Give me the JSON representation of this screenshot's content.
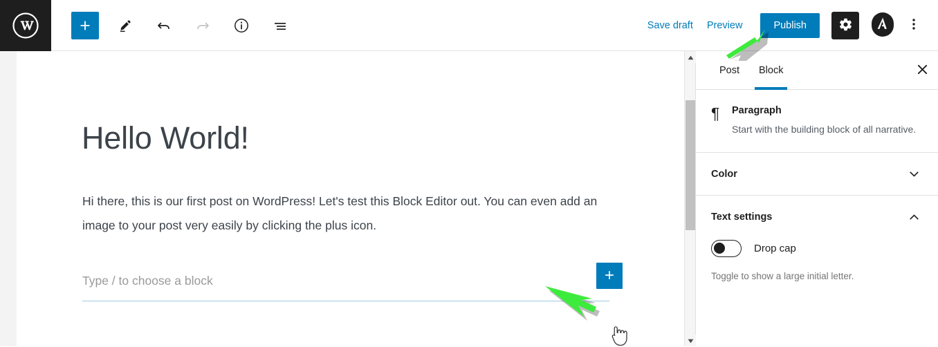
{
  "app": {
    "name": "WordPress Block Editor",
    "logo_icon": "wordpress-logo-icon"
  },
  "toolbar": {
    "add_block_label": "+",
    "add_block_icon": "plus-icon",
    "edit_icon": "pencil-icon",
    "undo_icon": "undo-arrow-icon",
    "redo_icon": "redo-arrow-icon",
    "info_icon": "info-circle-icon",
    "list_view_icon": "list-view-icon",
    "save_draft_label": "Save draft",
    "preview_label": "Preview",
    "publish_label": "Publish",
    "settings_icon": "gear-icon",
    "avatar_icon": "user-avatar-icon",
    "more_menu_icon": "kebab-menu-icon"
  },
  "editor": {
    "post_title": "Hello World!",
    "post_body": "Hi there, this is our first post on WordPress! Let's test this Block Editor out. You can even add an image to your post very easily by clicking the plus icon.",
    "empty_block_placeholder": "Type / to choose a block",
    "inline_add_block_label": "+",
    "inline_add_block_icon": "plus-icon",
    "cursor_icon": "pointing-hand-cursor-icon"
  },
  "annotations": [
    {
      "name": "arrow-to-publish",
      "icon": "green-arrow-icon",
      "color": "#3ceb3c",
      "points_to": "Publish"
    },
    {
      "name": "arrow-to-add-block",
      "icon": "green-arrow-icon",
      "color": "#3ceb3c",
      "points_to": "inline add block"
    }
  ],
  "scrollbar": {
    "up_arrow_icon": "triangle-up-icon",
    "down_arrow_icon": "triangle-down-icon",
    "thumb_name": "scrollbar-thumb"
  },
  "sidebar": {
    "tabs": [
      {
        "label": "Post",
        "active": false
      },
      {
        "label": "Block",
        "active": true
      }
    ],
    "close_icon": "close-x-icon",
    "block_card": {
      "icon": "¶",
      "icon_name": "paragraph-pilcrow-icon",
      "title": "Paragraph",
      "description": "Start with the building block of all narrative."
    },
    "panels": [
      {
        "title": "Color",
        "expanded": false,
        "chevron": "chevron-down-icon"
      },
      {
        "title": "Text settings",
        "expanded": true,
        "chevron": "chevron-up-icon"
      }
    ],
    "text_settings": {
      "drop_cap_label": "Drop cap",
      "drop_cap_enabled": false,
      "help_text": "Toggle to show a large initial letter."
    }
  },
  "colors": {
    "accent_blue": "#007cba",
    "dark": "#1e1e1e",
    "annotation_green": "#3ceb3c",
    "text": "#3c434a",
    "muted": "#757575"
  }
}
